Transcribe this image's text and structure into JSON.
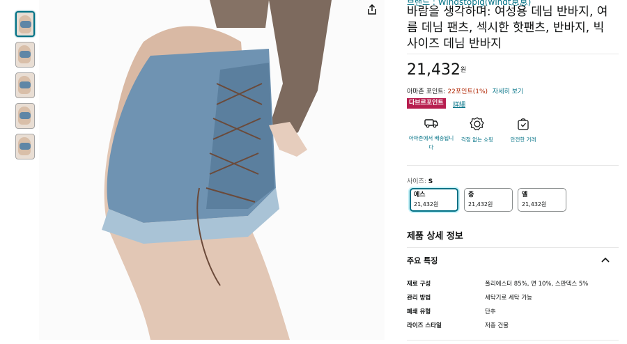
{
  "brand": {
    "text": "브랜드 : Windstopig(windt息息)"
  },
  "product": {
    "title": "바람을 생각하며: 여성용 데님 반바지, 여름 데님 팬츠, 섹시한 핫팬츠, 반바지, 빅 사이즈 데님 반바지",
    "price": "21,432",
    "price_unit": "원"
  },
  "points": {
    "label": "아마존 포인트:",
    "value": "22포인트(1%)",
    "link": "자세히 보기",
    "badge": "다브르포인트",
    "badge_link": "詳細"
  },
  "features": [
    {
      "icon": "delivery-truck-icon",
      "label": "아마존에서 배송됩니다"
    },
    {
      "icon": "badge-check-icon",
      "label": "걱정 없는 쇼핑"
    },
    {
      "icon": "secure-bag-icon",
      "label": "안전한 거래"
    }
  ],
  "size": {
    "label": "사이즈:",
    "selected": "S",
    "options": [
      {
        "name": "에스",
        "price": "21,432원"
      },
      {
        "name": "중",
        "price": "21,432원"
      },
      {
        "name": "엘",
        "price": "21,432원"
      }
    ]
  },
  "details": {
    "section_title": "제품 상세 정보",
    "accordion_title": "주요 특징",
    "specs": [
      {
        "key": "재료 구성",
        "value": "폴리에스터 85%, 면 10%, 스판덱스 5%"
      },
      {
        "key": "관리 방법",
        "value": "세탁기로 세탁 가능"
      },
      {
        "key": "폐쇄 유형",
        "value": "단추"
      },
      {
        "key": "라이즈 스타일",
        "value": "저층 건물"
      }
    ]
  },
  "colors": {
    "link": "#007185",
    "price_red": "#b12704",
    "badge": "#b71d4e",
    "denim": "#5f86a6"
  }
}
